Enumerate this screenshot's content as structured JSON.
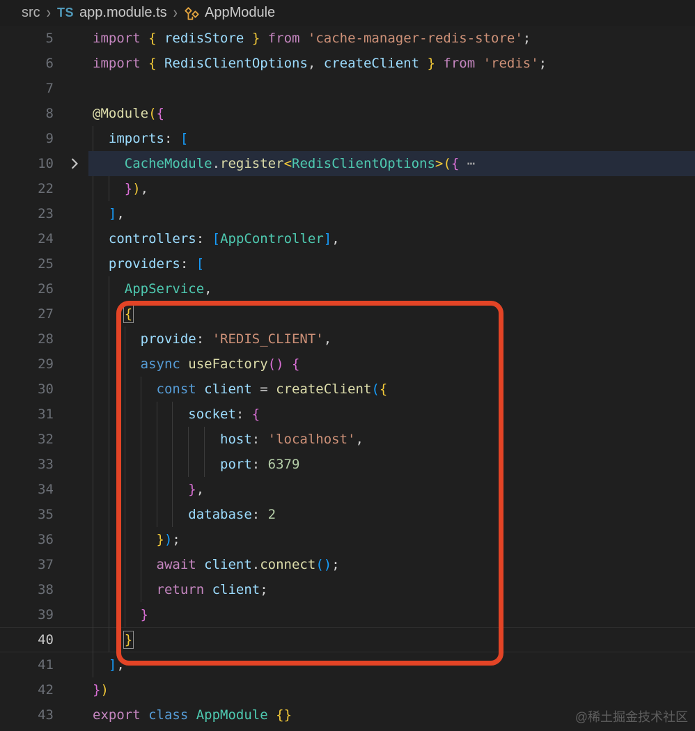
{
  "breadcrumb": {
    "root": "src",
    "separator": "›",
    "file_badge": "TS",
    "file": "app.module.ts",
    "symbol": "AppModule",
    "symbol_icon": "class-icon",
    "badge_color": "#519aba",
    "symbol_icon_color": "#e2a33e"
  },
  "editor": {
    "palette": {
      "kw": "#c586c0",
      "kb": "#569cd6",
      "var": "#9cdcfe",
      "str": "#ce9178",
      "num": "#b5cea8",
      "fn": "#dcdcaa",
      "cls": "#4ec9b0",
      "dec": "#dcdcaa",
      "pun": "#d4d4d4",
      "b1": "#f2c938",
      "b2": "#da70d6",
      "b3": "#179fff",
      "fold": "#a6a6a6"
    },
    "gutter_color": "#6b6f76",
    "gutter_active_color": "#c6c6c6",
    "folded_line_bg": "#252c3b",
    "lines": [
      {
        "n": 5,
        "ind": 0,
        "tokens": [
          [
            "kw",
            "import"
          ],
          [
            "pun",
            " "
          ],
          [
            "b1",
            "{"
          ],
          [
            "var",
            " redisStore "
          ],
          [
            "b1",
            "}"
          ],
          [
            "kw",
            " from"
          ],
          [
            "str",
            " 'cache-manager-redis-store'"
          ],
          [
            "pun",
            ";"
          ]
        ]
      },
      {
        "n": 6,
        "ind": 0,
        "tokens": [
          [
            "kw",
            "import"
          ],
          [
            "pun",
            " "
          ],
          [
            "b1",
            "{"
          ],
          [
            "var",
            " RedisClientOptions"
          ],
          [
            "pun",
            ","
          ],
          [
            "var",
            " createClient "
          ],
          [
            "b1",
            "}"
          ],
          [
            "kw",
            " from"
          ],
          [
            "str",
            " 'redis'"
          ],
          [
            "pun",
            ";"
          ]
        ]
      },
      {
        "n": 7,
        "ind": 0,
        "tokens": []
      },
      {
        "n": 8,
        "ind": 0,
        "tokens": [
          [
            "dec",
            "@Module"
          ],
          [
            "b1",
            "("
          ],
          [
            "b2",
            "{"
          ]
        ]
      },
      {
        "n": 9,
        "ind": 2,
        "tokens": [
          [
            "var",
            "imports"
          ],
          [
            "pun",
            ": "
          ],
          [
            "b3",
            "["
          ]
        ]
      },
      {
        "n": 10,
        "ind": 4,
        "fold": true,
        "hl": true,
        "tokens": [
          [
            "cls",
            "CacheModule"
          ],
          [
            "pun",
            "."
          ],
          [
            "fn",
            "register"
          ],
          [
            "b1",
            "<"
          ],
          [
            "cls",
            "RedisClientOptions"
          ],
          [
            "b1",
            ">"
          ],
          [
            "b1",
            "("
          ],
          [
            "b2",
            "{"
          ],
          [
            "fold",
            " ⋯"
          ]
        ]
      },
      {
        "n": 22,
        "ind": 4,
        "tokens": [
          [
            "b2",
            "}"
          ],
          [
            "b1",
            ")"
          ],
          [
            "pun",
            ","
          ]
        ]
      },
      {
        "n": 23,
        "ind": 2,
        "tokens": [
          [
            "b3",
            "]"
          ],
          [
            "pun",
            ","
          ]
        ]
      },
      {
        "n": 24,
        "ind": 2,
        "tokens": [
          [
            "var",
            "controllers"
          ],
          [
            "pun",
            ": "
          ],
          [
            "b3",
            "["
          ],
          [
            "cls",
            "AppController"
          ],
          [
            "b3",
            "]"
          ],
          [
            "pun",
            ","
          ]
        ]
      },
      {
        "n": 25,
        "ind": 2,
        "tokens": [
          [
            "var",
            "providers"
          ],
          [
            "pun",
            ": "
          ],
          [
            "b3",
            "["
          ]
        ]
      },
      {
        "n": 26,
        "ind": 4,
        "tokens": [
          [
            "cls",
            "AppService"
          ],
          [
            "pun",
            ","
          ]
        ]
      },
      {
        "n": 27,
        "ind": 4,
        "tokens": [
          [
            "b1",
            "{",
            "box"
          ]
        ]
      },
      {
        "n": 28,
        "ind": 6,
        "tokens": [
          [
            "var",
            "provide"
          ],
          [
            "pun",
            ": "
          ],
          [
            "str",
            "'REDIS_CLIENT'"
          ],
          [
            "pun",
            ","
          ]
        ]
      },
      {
        "n": 29,
        "ind": 6,
        "tokens": [
          [
            "kb",
            "async "
          ],
          [
            "fn",
            "useFactory"
          ],
          [
            "b2",
            "("
          ],
          [
            "b2",
            ")"
          ],
          [
            "pun",
            " "
          ],
          [
            "b2",
            "{"
          ]
        ]
      },
      {
        "n": 30,
        "ind": 8,
        "tokens": [
          [
            "kb",
            "const "
          ],
          [
            "var",
            "client "
          ],
          [
            "pun",
            "= "
          ],
          [
            "fn",
            "createClient"
          ],
          [
            "b3",
            "("
          ],
          [
            "b1",
            "{"
          ]
        ]
      },
      {
        "n": 31,
        "ind": 12,
        "tokens": [
          [
            "var",
            "socket"
          ],
          [
            "pun",
            ": "
          ],
          [
            "b2",
            "{"
          ]
        ]
      },
      {
        "n": 32,
        "ind": 16,
        "tokens": [
          [
            "var",
            "host"
          ],
          [
            "pun",
            ": "
          ],
          [
            "str",
            "'localhost'"
          ],
          [
            "pun",
            ","
          ]
        ]
      },
      {
        "n": 33,
        "ind": 16,
        "tokens": [
          [
            "var",
            "port"
          ],
          [
            "pun",
            ": "
          ],
          [
            "num",
            "6379"
          ]
        ]
      },
      {
        "n": 34,
        "ind": 12,
        "tokens": [
          [
            "b2",
            "}"
          ],
          [
            "pun",
            ","
          ]
        ]
      },
      {
        "n": 35,
        "ind": 12,
        "tokens": [
          [
            "var",
            "database"
          ],
          [
            "pun",
            ": "
          ],
          [
            "num",
            "2"
          ]
        ]
      },
      {
        "n": 36,
        "ind": 8,
        "tokens": [
          [
            "b1",
            "}"
          ],
          [
            "b3",
            ")"
          ],
          [
            "pun",
            ";"
          ]
        ]
      },
      {
        "n": 37,
        "ind": 8,
        "tokens": [
          [
            "kw",
            "await "
          ],
          [
            "var",
            "client"
          ],
          [
            "pun",
            "."
          ],
          [
            "fn",
            "connect"
          ],
          [
            "b3",
            "("
          ],
          [
            "b3",
            ")"
          ],
          [
            "pun",
            ";"
          ]
        ]
      },
      {
        "n": 38,
        "ind": 8,
        "tokens": [
          [
            "kw",
            "return "
          ],
          [
            "var",
            "client"
          ],
          [
            "pun",
            ";"
          ]
        ]
      },
      {
        "n": 39,
        "ind": 6,
        "tokens": [
          [
            "b2",
            "}"
          ]
        ]
      },
      {
        "n": 40,
        "ind": 4,
        "cur": true,
        "tokens": [
          [
            "b1",
            "}",
            "box"
          ]
        ]
      },
      {
        "n": 41,
        "ind": 2,
        "tokens": [
          [
            "b3",
            "]"
          ],
          [
            "pun",
            ","
          ]
        ]
      },
      {
        "n": 42,
        "ind": 0,
        "tokens": [
          [
            "b2",
            "}"
          ],
          [
            "b1",
            ")"
          ]
        ]
      },
      {
        "n": 43,
        "ind": 0,
        "tokens": [
          [
            "kw",
            "export "
          ],
          [
            "kb",
            "class "
          ],
          [
            "cls",
            "AppModule "
          ],
          [
            "b1",
            "{"
          ],
          [
            "b1",
            "}"
          ]
        ]
      }
    ]
  },
  "annotation": {
    "shape": "rounded-rectangle",
    "color": "#e34426",
    "highlights_lines": "27-40"
  },
  "watermark": "@稀土掘金技术社区"
}
